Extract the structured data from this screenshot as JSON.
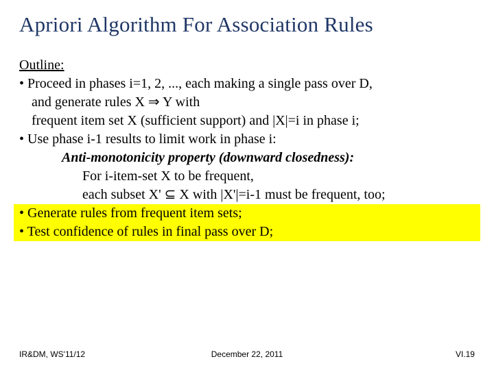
{
  "title": "Apriori Algorithm For Association Rules",
  "outline_label": "Outline:",
  "bullet1_l1": "• Proceed in phases i=1, 2, ..., each making a single pass over D,",
  "bullet1_l2": "and generate rules X ⇒ Y with",
  "bullet1_l3": "frequent item set X  (sufficient support) and |X|=i in phase i;",
  "bullet2_l1": "•  Use phase i-1 results to limit work in phase i:",
  "anti_mono": "Anti-monotonicity property (downward closedness):",
  "anti_l1": "For i-item-set X to be frequent,",
  "anti_l2": "each subset X' ⊆ X with |X'|=i-1 must be frequent, too;",
  "bullet3": "• Generate rules from frequent item sets;",
  "bullet4": "• Test confidence of rules in final pass over D;",
  "footer_left": "IR&DM, WS'11/12",
  "footer_center": "December 22, 2011",
  "footer_right": "VI.19"
}
